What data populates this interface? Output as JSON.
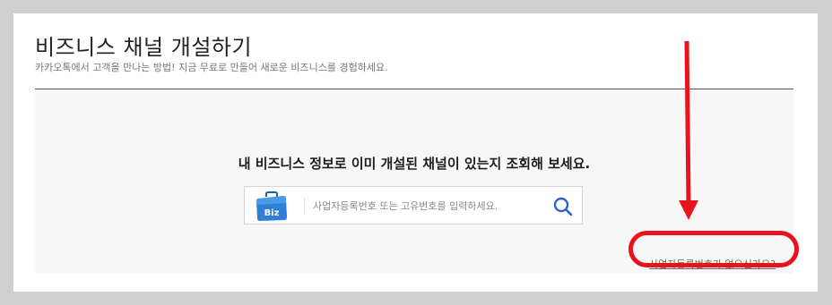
{
  "page": {
    "title": "비즈니스 채널 개설하기",
    "subtitle": "카카오톡에서 고객을 만나는 방법! 지금 무료로 만들어 새로운 비즈니스를 경험하세요."
  },
  "lookup": {
    "headline": "내 비즈니스 정보로 이미 개설된 채널이 있는지 조회해 보세요.",
    "icon_label": "Biz",
    "search": {
      "value": "",
      "placeholder": "사업자등록번호 또는 고유번호를 입력하세요."
    },
    "no_business_number_link": "사업자등록번호가 없으신가요?"
  },
  "icons": {
    "brand": "briefcase-biz-icon",
    "search": "search-icon"
  },
  "colors": {
    "panel_bg": "#f7f7f7",
    "icon_blue": "#2f7fd6",
    "search_icon": "#2a63c9",
    "annotation_red": "#e8141b"
  }
}
